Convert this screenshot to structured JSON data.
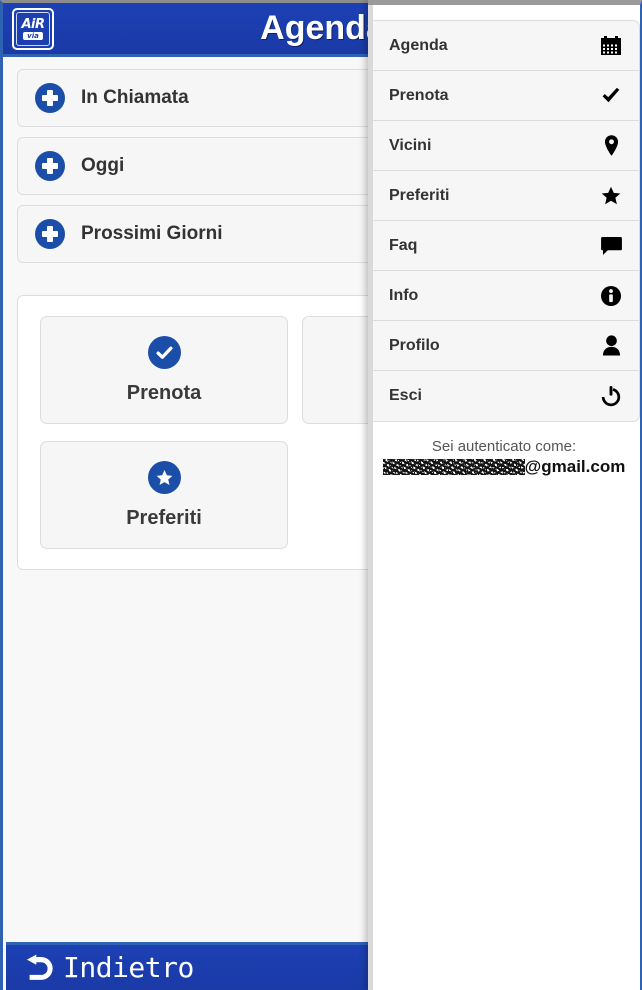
{
  "window": {
    "accent_blue": "#1b3fb0",
    "border_blue": "#2f62b3"
  },
  "header": {
    "title": "Agenda",
    "logo": {
      "word": "AiR",
      "sub": "via"
    }
  },
  "main": {
    "collapsibles": [
      {
        "label": "In Chiamata",
        "icon": "plus-circle-icon"
      },
      {
        "label": "Oggi",
        "icon": "plus-circle-icon"
      },
      {
        "label": "Prossimi Giorni",
        "icon": "plus-circle-icon"
      }
    ],
    "tiles": [
      {
        "label": "Prenota",
        "icon": "check-circle-icon"
      },
      {
        "label": "",
        "icon": ""
      },
      {
        "label": "Preferiti",
        "icon": "star-circle-icon"
      }
    ]
  },
  "footer": {
    "back_label": "Indietro",
    "back_icon": "back-arrow-icon"
  },
  "menu": {
    "items": [
      {
        "label": "Agenda",
        "icon": "calendar-icon"
      },
      {
        "label": "Prenota",
        "icon": "check-icon"
      },
      {
        "label": "Vicini",
        "icon": "map-pin-icon"
      },
      {
        "label": "Preferiti",
        "icon": "star-icon"
      },
      {
        "label": "Faq",
        "icon": "speech-bubble-icon"
      },
      {
        "label": "Info",
        "icon": "info-circle-icon"
      },
      {
        "label": "Profilo",
        "icon": "person-icon"
      },
      {
        "label": "Esci",
        "icon": "power-icon"
      }
    ],
    "auth": {
      "title": "Sei autenticato come:",
      "email_suffix": "@gmail.com"
    }
  }
}
